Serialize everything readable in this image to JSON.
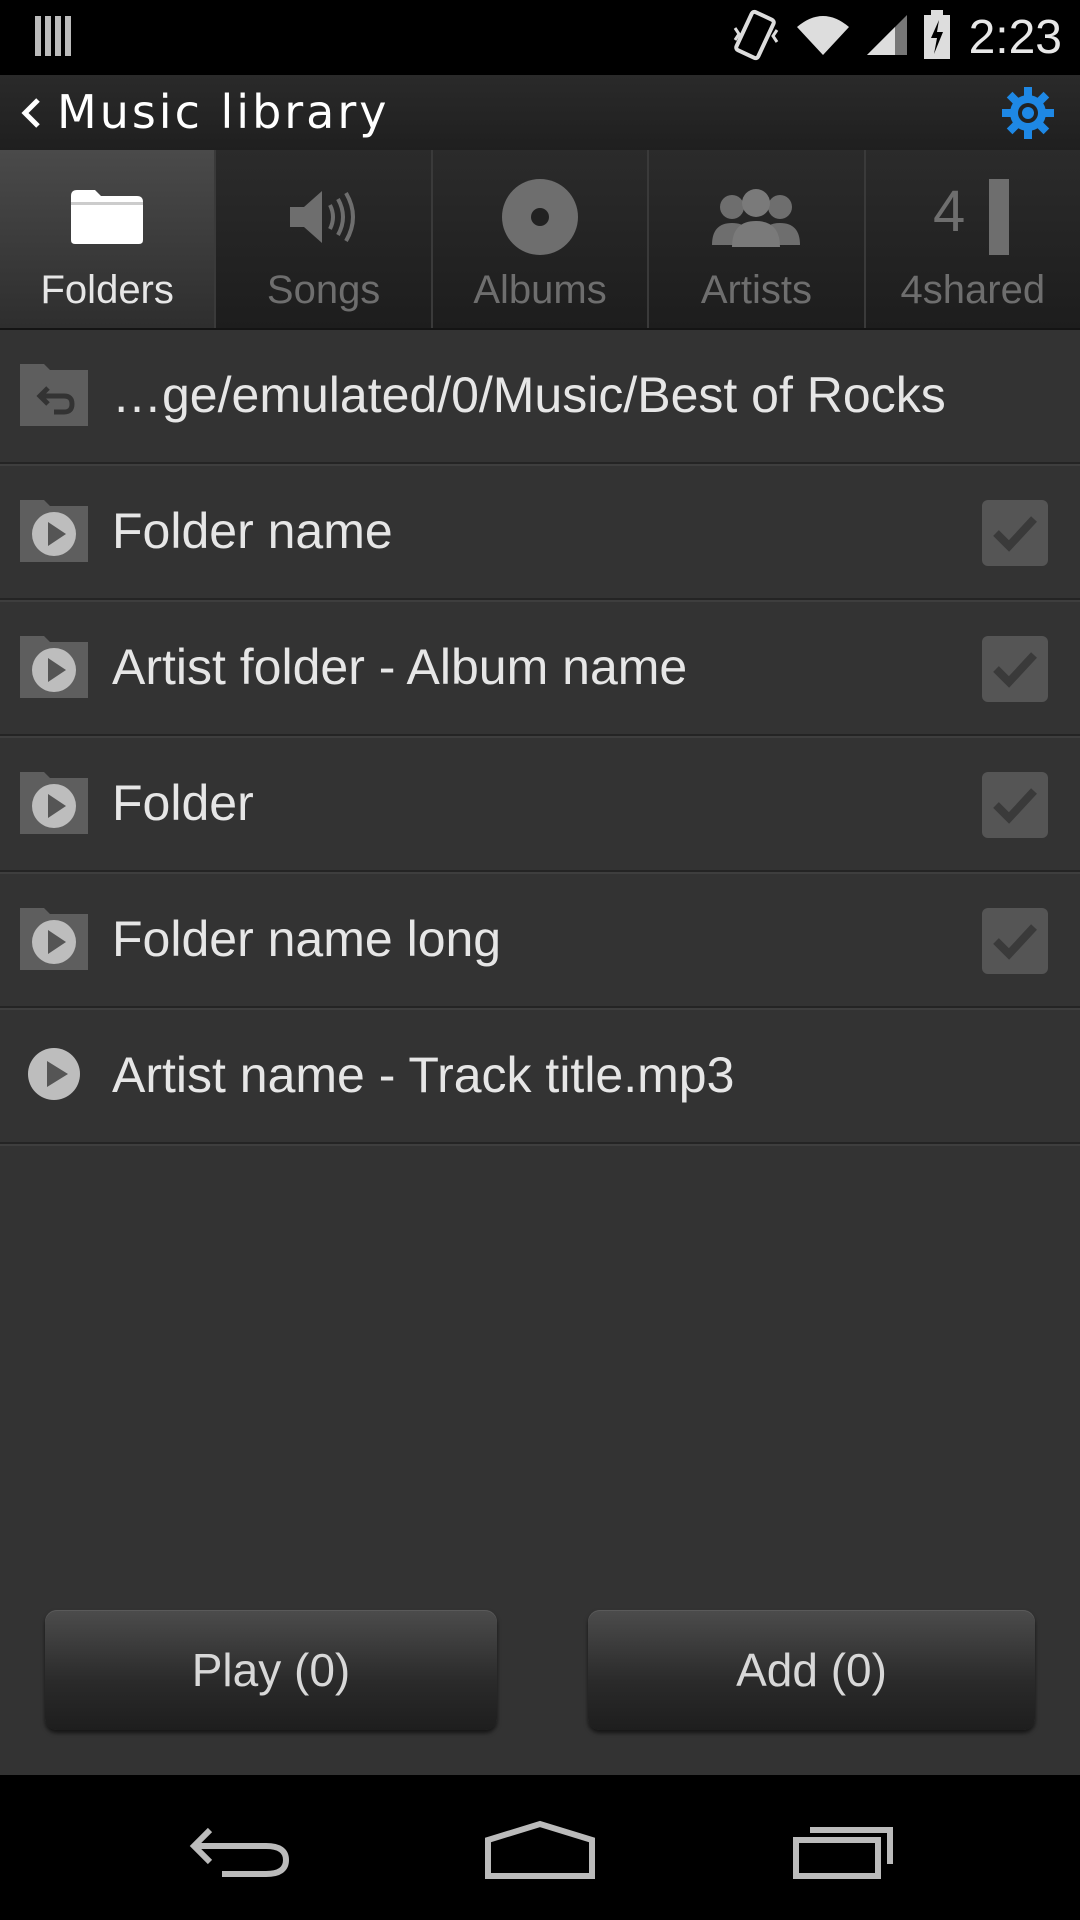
{
  "status_bar": {
    "time": "2:23"
  },
  "action_bar": {
    "title": "Music library"
  },
  "tabs": [
    {
      "label": "Folders",
      "icon": "folder-icon",
      "active": true
    },
    {
      "label": "Songs",
      "icon": "speaker-icon",
      "active": false
    },
    {
      "label": "Albums",
      "icon": "disc-icon",
      "active": false
    },
    {
      "label": "Artists",
      "icon": "people-icon",
      "active": false
    },
    {
      "label": "4shared",
      "icon": "4shared-icon",
      "active": false
    }
  ],
  "path_row": {
    "path": "…ge/emulated/0/Music/Best of Rocks",
    "icon": "folder-up-icon"
  },
  "list": [
    {
      "label": "Folder name",
      "type": "folder",
      "checkbox": true
    },
    {
      "label": "Artist folder - Album name",
      "type": "folder",
      "checkbox": true
    },
    {
      "label": "Folder",
      "type": "folder",
      "checkbox": true
    },
    {
      "label": "Folder name long",
      "type": "folder",
      "checkbox": true
    },
    {
      "label": "Artist name - Track title.mp3",
      "type": "track",
      "checkbox": false
    }
  ],
  "buttons": {
    "play": "Play (0)",
    "add": "Add (0)"
  },
  "colors": {
    "accent": "#1e88e5",
    "background": "#333333"
  }
}
